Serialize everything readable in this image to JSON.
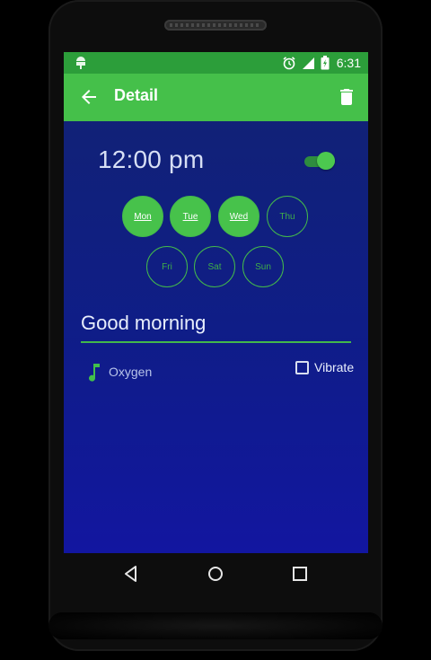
{
  "status_bar": {
    "time": "6:31"
  },
  "app_bar": {
    "title": "Detail"
  },
  "alarm": {
    "time": "12:00 pm",
    "enabled": true
  },
  "days": [
    {
      "label": "Mon",
      "selected": true
    },
    {
      "label": "Tue",
      "selected": true
    },
    {
      "label": "Wed",
      "selected": true
    },
    {
      "label": "Thu",
      "selected": false
    },
    {
      "label": "Fri",
      "selected": false
    },
    {
      "label": "Sat",
      "selected": false
    },
    {
      "label": "Sun",
      "selected": false
    }
  ],
  "label_field": {
    "value": "Good morning"
  },
  "ringtone": {
    "name": "Oxygen"
  },
  "vibrate": {
    "label": "Vibrate",
    "checked": false
  },
  "colors": {
    "accent": "#45c04a",
    "status_bar": "#2c9e3a",
    "background": "#0f1d87"
  }
}
